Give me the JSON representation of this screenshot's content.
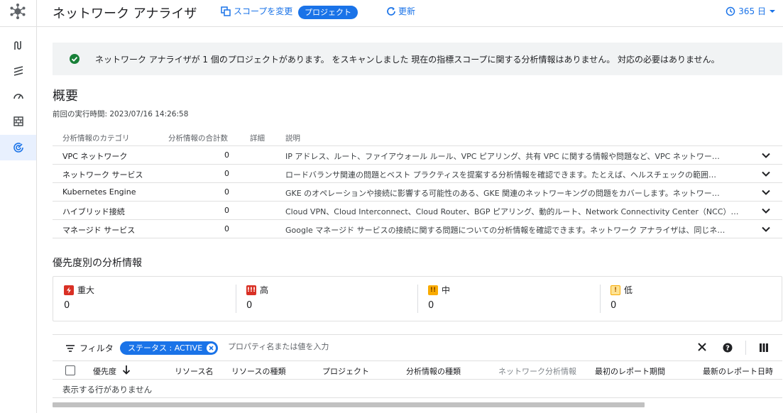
{
  "header": {
    "title": "ネットワーク アナライザ",
    "change_scope_label": "スコープを変更",
    "project_chip": "プロジェクト",
    "refresh_label": "更新",
    "range_label": "365 日"
  },
  "banner": {
    "text": "ネットワーク アナライザが 1 個のプロジェクトがあります。 をスキャンしました 現在の指標スコープに関する分析情報はありません。 対応の必要はありません。"
  },
  "overview": {
    "title": "概要",
    "last_run": "前回の実行時間: 2023/07/16 14:26:58"
  },
  "category_table": {
    "headers": {
      "category": "分析情報のカテゴリ",
      "total": "分析情報の合計数",
      "detail": "詳細",
      "description": "説明"
    },
    "rows": [
      {
        "name": "VPC ネットワーク",
        "count": "0",
        "description": "IP アドレス、ルート、ファイアウォール ルール、VPC ピアリング、共有 VPC に関する情報や問題など、VPC ネットワー…"
      },
      {
        "name": "ネットワーク サービス",
        "count": "0",
        "description": "ロードバランサ関連の問題とベスト プラクティスを提案する分析情報を確認できます。たとえば、ヘルスチェックの範囲…"
      },
      {
        "name": "Kubernetes Engine",
        "count": "0",
        "description": "GKE のオペレーションや接続に影響する可能性のある、GKE 関連のネットワーキングの問題をカバーします。ネットワー…"
      },
      {
        "name": "ハイブリッド接続",
        "count": "0",
        "description": "Cloud VPN、Cloud Interconnect、Cloud Router、BGP ピアリング、動的ルート、Network Connectivity Center（NCC）に関…"
      },
      {
        "name": "マネージド サービス",
        "count": "0",
        "description": "Google マネージド サービスの接続に関する問題についての分析情報を確認できます。ネットワーク アナライザは、同じネ…"
      }
    ]
  },
  "priority": {
    "title": "優先度別の分析情報",
    "items": [
      {
        "label": "重大",
        "count": "0",
        "icon": "bolt-icon",
        "color": "#d93025"
      },
      {
        "label": "高",
        "count": "0",
        "icon": "triple-exclamation-icon",
        "color": "#d93025"
      },
      {
        "label": "中",
        "count": "0",
        "icon": "double-exclamation-icon",
        "color": "#f9ab00"
      },
      {
        "label": "低",
        "count": "0",
        "icon": "exclamation-icon",
        "color": "#fbbc04"
      }
    ]
  },
  "filter": {
    "label": "フィルタ",
    "chip": "ステータス : ACTIVE",
    "placeholder": "プロパティ名または値を入力"
  },
  "results_table": {
    "headers": {
      "priority": "優先度",
      "resource_name": "リソース名",
      "resource_type": "リソースの種類",
      "project": "プロジェクト",
      "insight_type": "分析情報の種類",
      "network_insight": "ネットワーク分析情報",
      "first_report": "最初のレポート期間",
      "latest_report": "最新のレポート日時"
    },
    "empty_text": "表示する行がありません"
  },
  "colors": {
    "accent": "#1a73e8",
    "success": "#188038"
  }
}
